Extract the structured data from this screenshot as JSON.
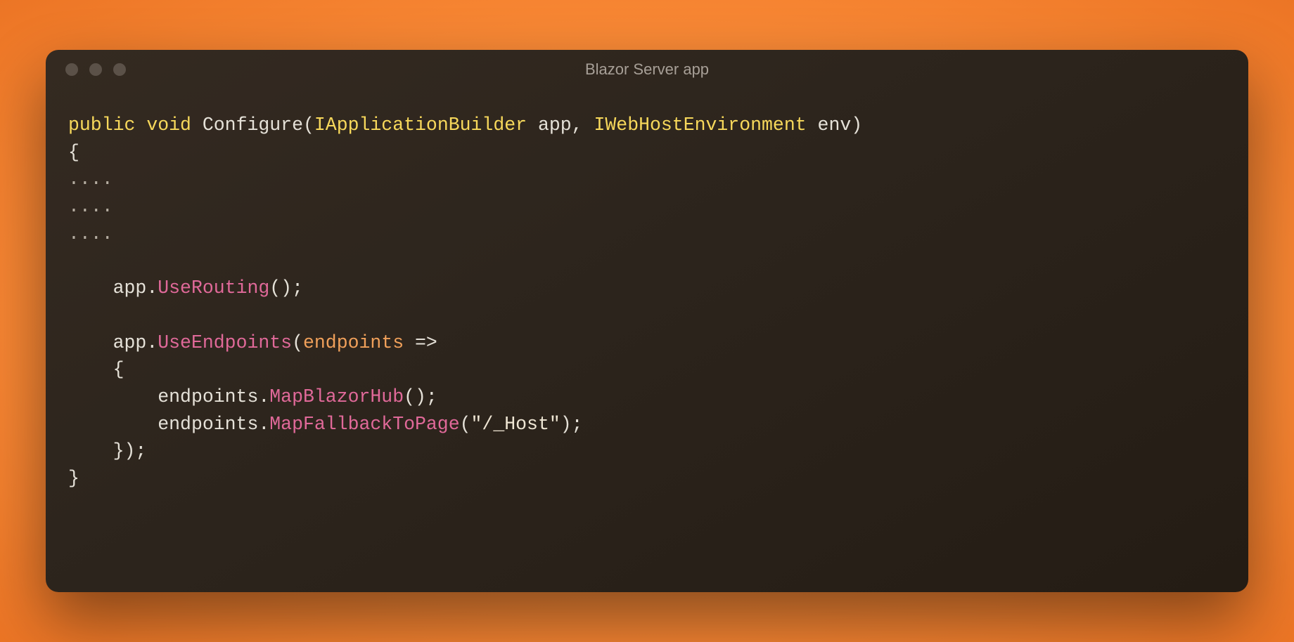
{
  "window": {
    "title": "Blazor Server app"
  },
  "code": {
    "line1": {
      "kw_public": "public",
      "kw_void": "void",
      "fn": "Configure",
      "open": "(",
      "type1": "IApplicationBuilder",
      "arg1": " app",
      "comma": ",",
      "type2": " IWebHostEnvironment",
      "arg2": " env",
      "close": ")"
    },
    "line2": "{",
    "line3": "....",
    "line4": "....",
    "line5": "....",
    "line7_indent": "    ",
    "line7_obj": "app.",
    "line7_method": "UseRouting",
    "line7_tail": "();",
    "line9_indent": "    ",
    "line9_obj": "app.",
    "line9_method": "UseEndpoints",
    "line9_open": "(",
    "line9_param": "endpoints",
    "line9_arrow": " =>",
    "line10": "    {",
    "line11_indent": "        ",
    "line11_obj": "endpoints.",
    "line11_method": "MapBlazorHub",
    "line11_tail": "();",
    "line12_indent": "        ",
    "line12_obj": "endpoints.",
    "line12_method": "MapFallbackToPage",
    "line12_open": "(",
    "line12_str": "\"/_Host\"",
    "line12_close": ");",
    "line13": "    });",
    "line14": "}"
  }
}
